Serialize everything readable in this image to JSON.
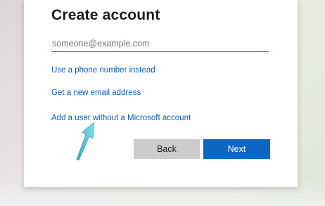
{
  "dialog": {
    "title": "Create account",
    "email_placeholder": "someone@example.com",
    "email_value": "",
    "links": {
      "phone": "Use a phone number instead",
      "new_email": "Get a new email address",
      "no_msa": "Add a user without a Microsoft account"
    },
    "buttons": {
      "back": "Back",
      "next": "Next"
    }
  },
  "annotation": {
    "icon": "pointer-arrow-icon",
    "color": "#5bc7d6"
  },
  "colors": {
    "accent": "#0a68c2",
    "link": "#0b5fb0",
    "back_button": "#cccccc"
  }
}
